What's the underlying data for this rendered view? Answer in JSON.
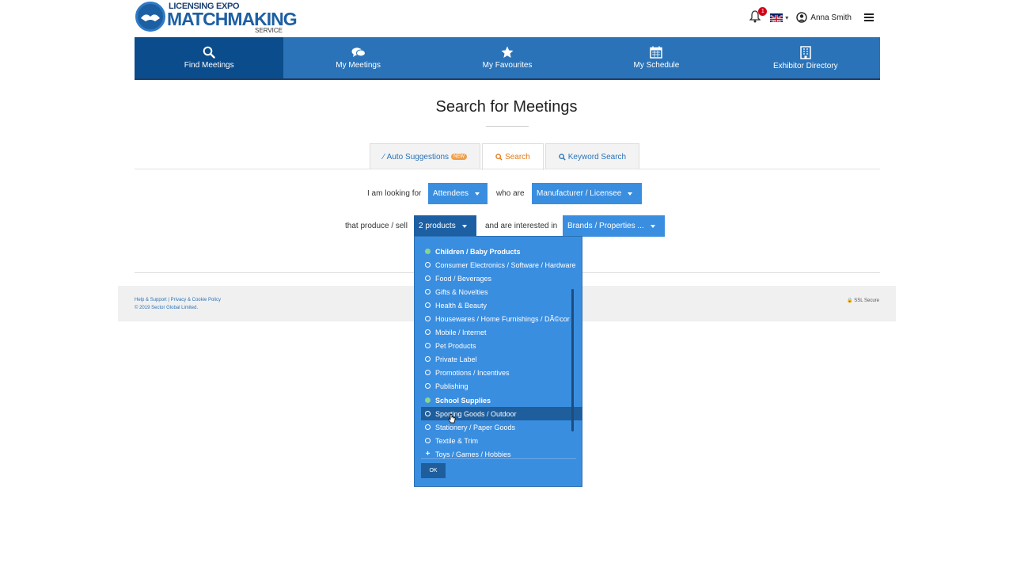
{
  "brand": {
    "line1": "LICENSING EXPO",
    "line2": "MATCHMAKING",
    "line3": "SERVICE"
  },
  "topbar": {
    "notifications_count": "1",
    "user_name": "Anna Smith",
    "icons": [
      "bell-icon",
      "uk-flag-icon",
      "user-icon",
      "hamburger-icon"
    ]
  },
  "nav": {
    "items": [
      {
        "label": "Find Meetings",
        "icon": "search-icon",
        "active": true
      },
      {
        "label": "My Meetings",
        "icon": "chat-icon",
        "active": false
      },
      {
        "label": "My Favourites",
        "icon": "star-icon",
        "active": false
      },
      {
        "label": "My Schedule",
        "icon": "calendar-icon",
        "active": false
      },
      {
        "label": "Exhibitor Directory",
        "icon": "building-icon",
        "active": false
      }
    ]
  },
  "page": {
    "title": "Search for Meetings"
  },
  "tabs": [
    {
      "label": "Auto Suggestions",
      "badge": "NEW",
      "icon": "wand-icon",
      "active": false
    },
    {
      "label": "Search",
      "icon": "search-icon",
      "active": true
    },
    {
      "label": "Keyword Search",
      "icon": "search-icon",
      "active": false
    }
  ],
  "form": {
    "looking_for_label": "I am looking for",
    "looking_for_value": "Attendees",
    "who_are_label": "who are",
    "who_are_value": "Manufacturer / Licensee",
    "produce_label": "that produce / sell",
    "produce_value": "2 products",
    "interested_label": "and are interested in",
    "interested_value": "Brands / Properties ..."
  },
  "product_options": [
    {
      "label": "Children / Baby Products",
      "state": "checked"
    },
    {
      "label": "Consumer Electronics / Software / Hardware",
      "state": "unchecked"
    },
    {
      "label": "Food / Beverages",
      "state": "unchecked"
    },
    {
      "label": "Gifts & Novelties",
      "state": "unchecked"
    },
    {
      "label": "Health & Beauty",
      "state": "unchecked"
    },
    {
      "label": "Housewares / Home Furnishings / DÃ©cor",
      "state": "unchecked"
    },
    {
      "label": "Mobile / Internet",
      "state": "unchecked"
    },
    {
      "label": "Pet Products",
      "state": "unchecked"
    },
    {
      "label": "Private Label",
      "state": "unchecked"
    },
    {
      "label": "Promotions / Incentives",
      "state": "unchecked"
    },
    {
      "label": "Publishing",
      "state": "unchecked"
    },
    {
      "label": "School Supplies",
      "state": "checked"
    },
    {
      "label": "Sporting Goods / Outdoor",
      "state": "hover"
    },
    {
      "label": "Stationery / Paper Goods",
      "state": "unchecked"
    },
    {
      "label": "Textile & Trim",
      "state": "unchecked"
    },
    {
      "label": "Toys / Games / Hobbies",
      "state": "expand"
    }
  ],
  "panel": {
    "ok_label": "OK"
  },
  "footer": {
    "help": "Help & Support",
    "sep": "|",
    "privacy": "Privacy & Cookie Policy",
    "copyright": "© 2019 Sector Global Limited.",
    "ssl": "SSL Secure"
  }
}
